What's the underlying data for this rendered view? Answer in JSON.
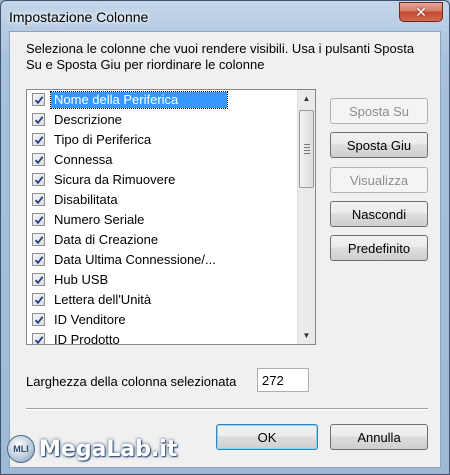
{
  "window": {
    "title": "Impostazione Colonne",
    "close_symbol": "✕"
  },
  "description": "Seleziona le colonne che vuoi rendere visibili. Usa i pulsanti Sposta Su e Sposta Giu per riordinare le colonne",
  "columns": [
    {
      "label": "Nome della Periferica",
      "checked": true,
      "selected": true
    },
    {
      "label": "Descrizione",
      "checked": true
    },
    {
      "label": "Tipo di Periferica",
      "checked": true
    },
    {
      "label": "Connessa",
      "checked": true
    },
    {
      "label": "Sicura da Rimuovere",
      "checked": true
    },
    {
      "label": "Disabilitata",
      "checked": true
    },
    {
      "label": "Numero Seriale",
      "checked": true
    },
    {
      "label": "Data di Creazione",
      "checked": true
    },
    {
      "label": "Data Ultima Connessione/...",
      "checked": true
    },
    {
      "label": "Hub USB",
      "checked": true
    },
    {
      "label": "Lettera dell'Unità",
      "checked": true
    },
    {
      "label": "ID Venditore",
      "checked": true
    },
    {
      "label": "ID Prodotto",
      "checked": true
    }
  ],
  "buttons": {
    "move_up": {
      "label": "Sposta Su",
      "enabled": false
    },
    "move_down": {
      "label": "Sposta Giu",
      "enabled": true
    },
    "show": {
      "label": "Visualizza",
      "enabled": false
    },
    "hide": {
      "label": "Nascondi",
      "enabled": true
    },
    "default": {
      "label": "Predefinito",
      "enabled": true
    },
    "ok": {
      "label": "OK"
    },
    "cancel": {
      "label": "Annulla"
    }
  },
  "column_width": {
    "label": "Larghezza della colonna selezionata",
    "value": "272"
  },
  "watermark": {
    "mark": "MLI",
    "text": "MegaLab.it"
  },
  "colors": {
    "selection": "#3399ff",
    "close_button": "#c44a32",
    "title_bar": "#b5cbe2"
  }
}
